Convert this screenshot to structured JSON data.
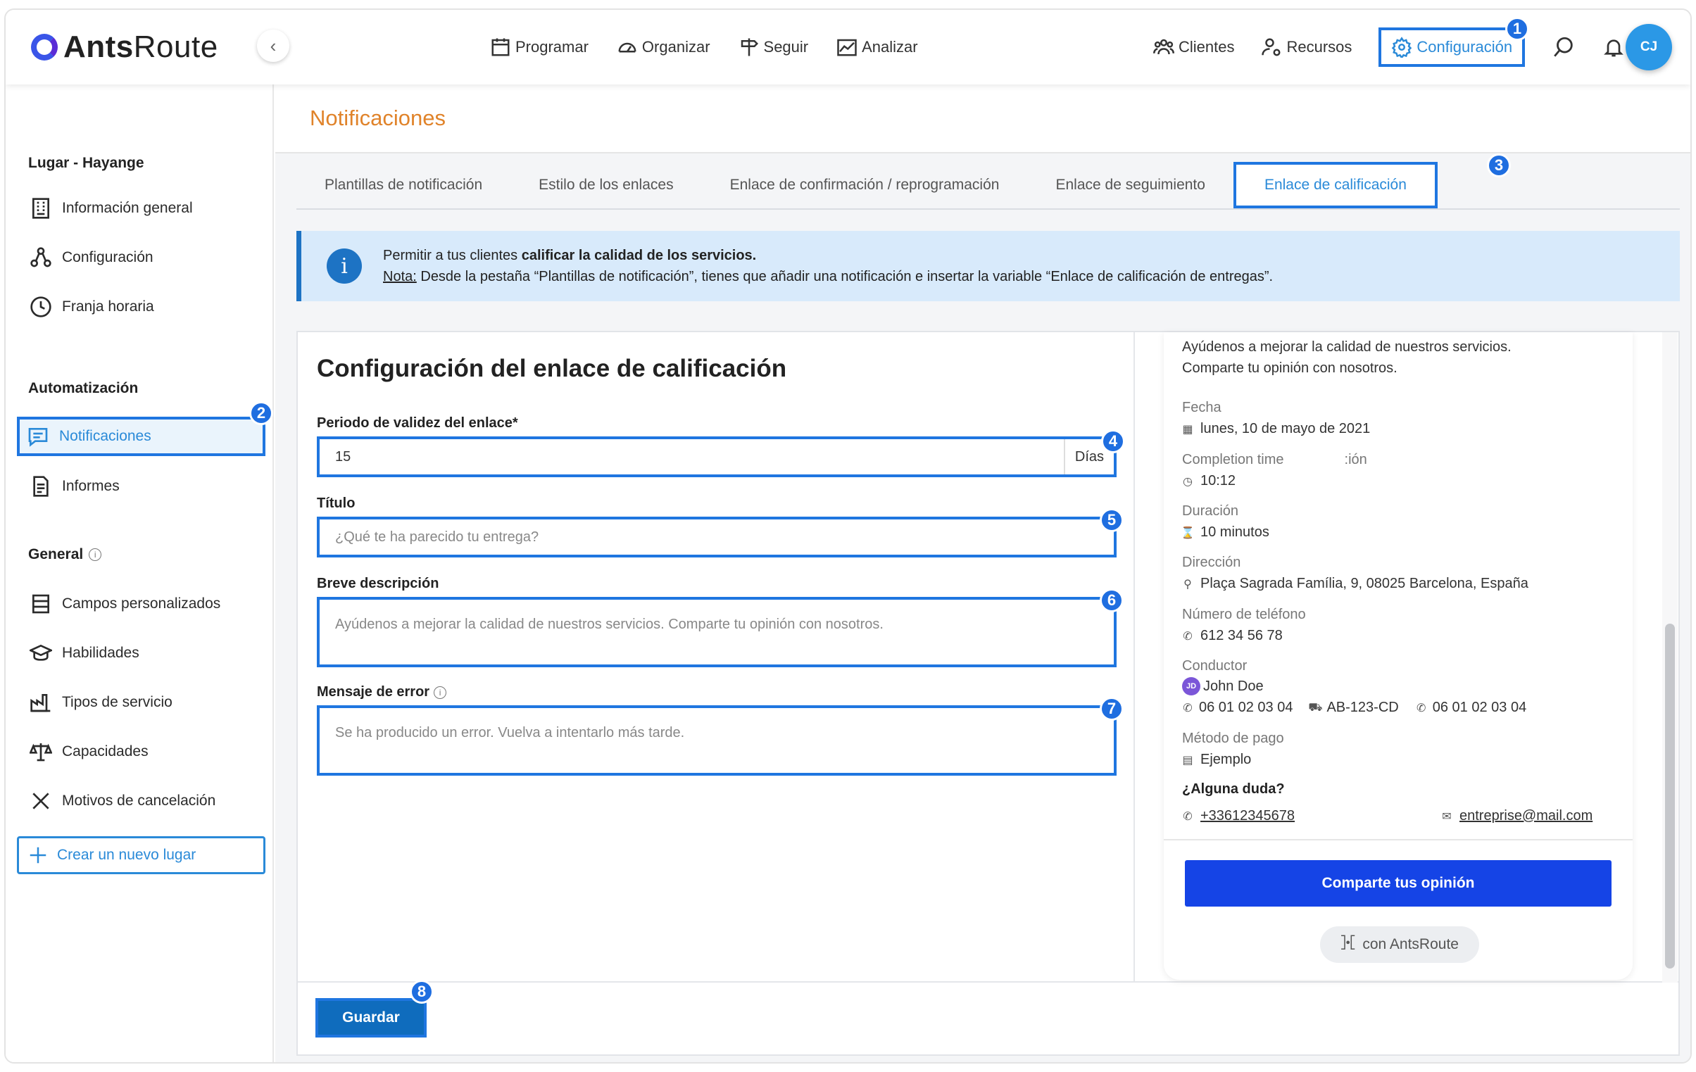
{
  "header": {
    "logo_text_1": "Ants",
    "logo_text_2": "Route",
    "nav_left": [
      "Programar",
      "Organizar",
      "Seguir",
      "Analizar"
    ],
    "nav_clients": "Clientes",
    "nav_resources": "Recursos",
    "nav_config": "Configuración",
    "avatar_initials": "CJ"
  },
  "badges": [
    "1",
    "2",
    "3",
    "4",
    "5",
    "6",
    "7",
    "8"
  ],
  "page_title": "Notificaciones",
  "sidebar": {
    "section_place": "Lugar - Hayange",
    "place_items": [
      "Información general",
      "Configuración",
      "Franja horaria"
    ],
    "section_auto": "Automatización",
    "auto_items": [
      "Notificaciones",
      "Informes"
    ],
    "section_general": "General",
    "general_items": [
      "Campos personalizados",
      "Habilidades",
      "Tipos de servicio",
      "Capacidades",
      "Motivos de cancelación"
    ],
    "new_place": "Crear un nuevo lugar"
  },
  "tabs": [
    "Plantillas de notificación",
    "Estilo de los enlaces",
    "Enlace de confirmación / reprogramación",
    "Enlace de seguimiento",
    "Enlace de calificación"
  ],
  "info": {
    "line1_prefix": "Permitir a tus clientes ",
    "line1_bold": "calificar la calidad de los servicios.",
    "note_label": "Nota:",
    "note_text": " Desde la pestaña “Plantillas de notificación”, tienes que añadir una notificación e insertar la variable “Enlace de calificación de entregas”."
  },
  "form": {
    "title": "Configuración del enlace de calificación",
    "validity_label": "Periodo de validez del enlace*",
    "validity_value": "15",
    "validity_unit": "Días",
    "title_label": "Título",
    "title_placeholder": "¿Qué te ha parecido tu entrega?",
    "desc_label": "Breve descripción",
    "desc_placeholder": "Ayúdenos a mejorar la calidad de nuestros servicios. Comparte tu opinión con nosotros.",
    "error_label": "Mensaje de error",
    "error_placeholder": "Se ha producido un error. Vuelva a intentarlo más tarde.",
    "save": "Guardar"
  },
  "preview": {
    "intro_1": "Ayúdenos a mejorar la calidad de nuestros servicios.",
    "intro_2": "Comparte tu opinión con nosotros.",
    "date_label": "Fecha",
    "date_value": "lunes, 10 de mayo de 2021",
    "time_label": "Completion time",
    "time_label_extra": ":ión",
    "time_value": "10:12",
    "duration_label": "Duración",
    "duration_value": "10 minutos",
    "address_label": "Dirección",
    "address_value": "Plaça Sagrada Família, 9, 08025 Barcelona, España",
    "phone_label": "Número de teléfono",
    "phone_value": "612 34 56 78",
    "driver_label": "Conductor",
    "driver_initials": "JD",
    "driver_name": "John Doe",
    "driver_phone": "06 01 02 03 04",
    "driver_plate": "AB-123-CD",
    "driver_phone2": "06 01 02 03 04",
    "payment_label": "Método de pago",
    "payment_value": "Ejemplo",
    "question": "¿Alguna duda?",
    "contact_phone": "+33612345678",
    "contact_email": "entreprise@mail.com",
    "share_button": "Comparte tus opinión",
    "powered": "con AntsRoute"
  }
}
